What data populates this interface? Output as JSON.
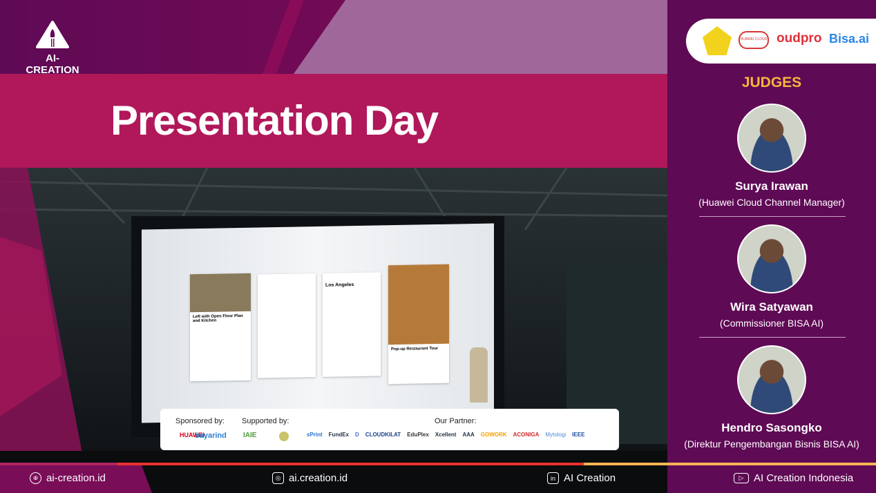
{
  "header": {
    "logo_text": "AI-CREATION",
    "title": "Presentation Day"
  },
  "partners_logos": [
    "Universitas logo",
    "HUAWEI CLOUD",
    "oudpro",
    "Bisa.ai"
  ],
  "judges": {
    "heading": "JUDGES",
    "items": [
      {
        "name": "Surya Irawan",
        "role": "(Huawei Cloud Channel Manager)"
      },
      {
        "name": "Wira Satyawan",
        "role": "(Commissioner BISA AI)"
      },
      {
        "name": "Hendro Sasongko",
        "role": "(Direktur Pengembangan Bisnis BISA AI)"
      }
    ]
  },
  "sponsors": {
    "sponsored_label": "Sponsored by:",
    "sponsored": [
      "HUAWEI",
      "bayarind"
    ],
    "supported_label": "Supported by:",
    "supported": [
      "IAIE",
      "seal"
    ],
    "partner_label": "Our Partner:",
    "partners": [
      "sPrint",
      "FundEx",
      "D",
      "CLOUDKILAT",
      "logo",
      "EduPlex",
      "Xcellent",
      "AAA",
      "crest",
      "GOWORK",
      "ACONIGA",
      "Mytologi",
      "IEEE",
      "logo"
    ]
  },
  "screen_cards": [
    "Left with Open Floor Plan and Kitchen",
    "Los Angeles",
    "Pop-up Restaurant Tour"
  ],
  "footer": {
    "website": "ai-creation.id",
    "instagram": "ai.creation.id",
    "linkedin": "AI Creation",
    "youtube": "AI Creation Indonesia"
  },
  "colors": {
    "purple": "#5f0a55",
    "crimson": "#b0185a",
    "accent": "#f7b53e"
  }
}
